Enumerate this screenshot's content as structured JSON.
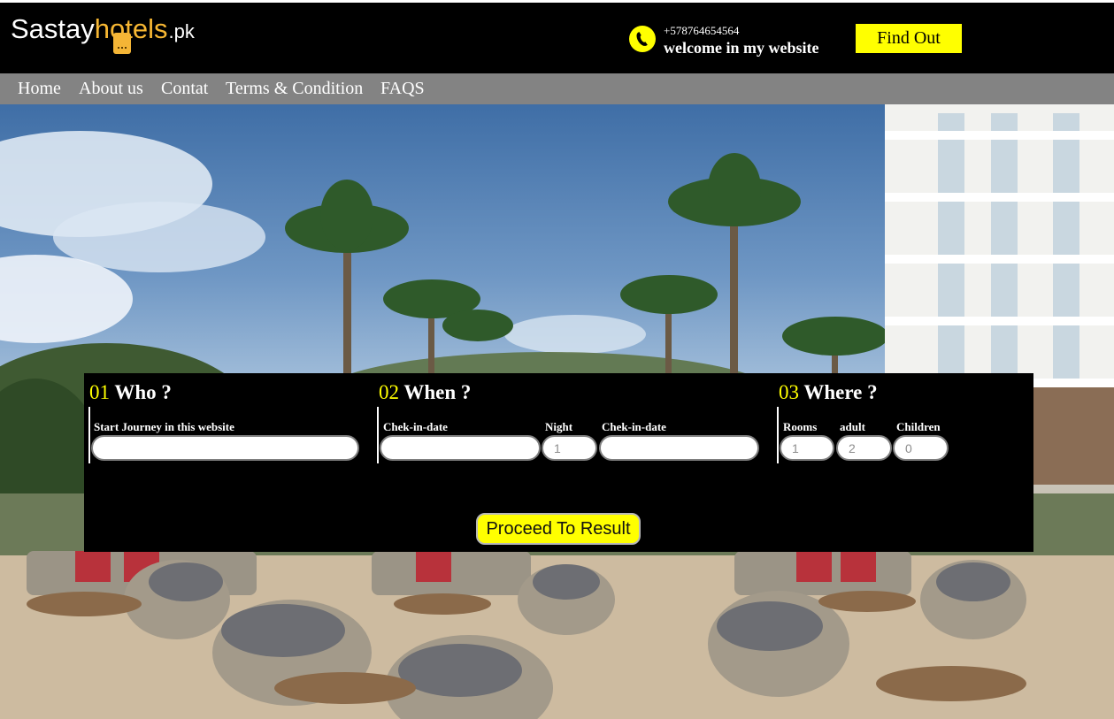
{
  "header": {
    "logo": {
      "part1": "Sastay",
      "part2": "hotels",
      "part3": ".pk"
    },
    "phone": "+578764654564",
    "welcome": "welcome in my website",
    "find_out_label": "Find Out"
  },
  "nav": {
    "items": [
      {
        "label": "Home"
      },
      {
        "label": "About us"
      },
      {
        "label": "Contat"
      },
      {
        "label": "Terms & Condition"
      },
      {
        "label": "FAQS"
      }
    ]
  },
  "search": {
    "who": {
      "number": "01",
      "title": " Who ?",
      "journey_label": "Start Journey in this website",
      "journey_value": ""
    },
    "when": {
      "number": "02",
      "title": " When ?",
      "checkin_label": "Chek-in-date",
      "checkin_value": "",
      "night_label": "Night",
      "night_placeholder": "1",
      "checkout_label": "Chek-in-date",
      "checkout_value": ""
    },
    "where": {
      "number": "03",
      "title": " Where ?",
      "rooms_label": "Rooms",
      "rooms_placeholder": "1",
      "adult_label": "adult",
      "adult_placeholder": "2",
      "children_label": "Children",
      "children_placeholder": "0"
    },
    "proceed_label": "Proceed To Result"
  },
  "icons": {
    "phone": "phone-icon",
    "logo_tag": "price-tag-icon"
  },
  "colors": {
    "header_bg": "#000000",
    "nav_bg": "#838383",
    "accent_yellow": "#ffff00",
    "logo_orange": "#f7b733"
  }
}
